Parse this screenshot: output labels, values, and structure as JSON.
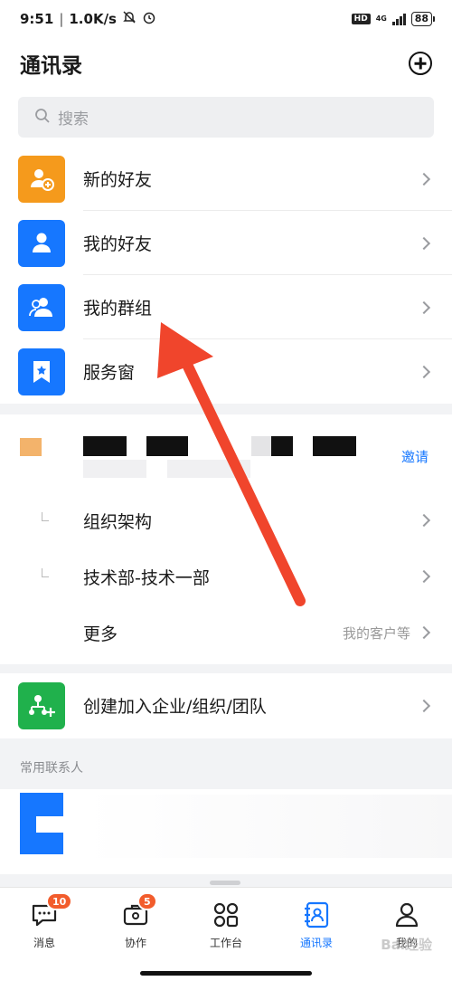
{
  "status_bar": {
    "time": "9:51",
    "net_speed": "1.0K/s",
    "network": "4G",
    "battery": "88"
  },
  "header": {
    "title": "通讯录"
  },
  "search": {
    "placeholder": "搜索"
  },
  "top_items": [
    {
      "label": "新的好友",
      "color": "#f59a1c",
      "icon": "new-friend-icon"
    },
    {
      "label": "我的好友",
      "color": "#1677ff",
      "icon": "friends-icon"
    },
    {
      "label": "我的群组",
      "color": "#1677ff",
      "icon": "groups-icon"
    },
    {
      "label": "服务窗",
      "color": "#1677ff",
      "icon": "service-window-icon"
    }
  ],
  "org": {
    "invite_label": "邀请",
    "items": [
      {
        "label": "组织架构"
      },
      {
        "label": "技术部-技术一部"
      },
      {
        "label": "更多",
        "aux": "我的客户等"
      }
    ]
  },
  "create_org": {
    "label": "创建加入企业/组织/团队",
    "color": "#20b14c"
  },
  "frequent_contacts": {
    "caption": "常用联系人"
  },
  "tabs": [
    {
      "label": "消息",
      "badge": "10"
    },
    {
      "label": "协作",
      "badge": "5"
    },
    {
      "label": "工作台"
    },
    {
      "label": "通讯录",
      "active": true
    },
    {
      "label": "我的"
    }
  ],
  "watermark": "Bai经验"
}
